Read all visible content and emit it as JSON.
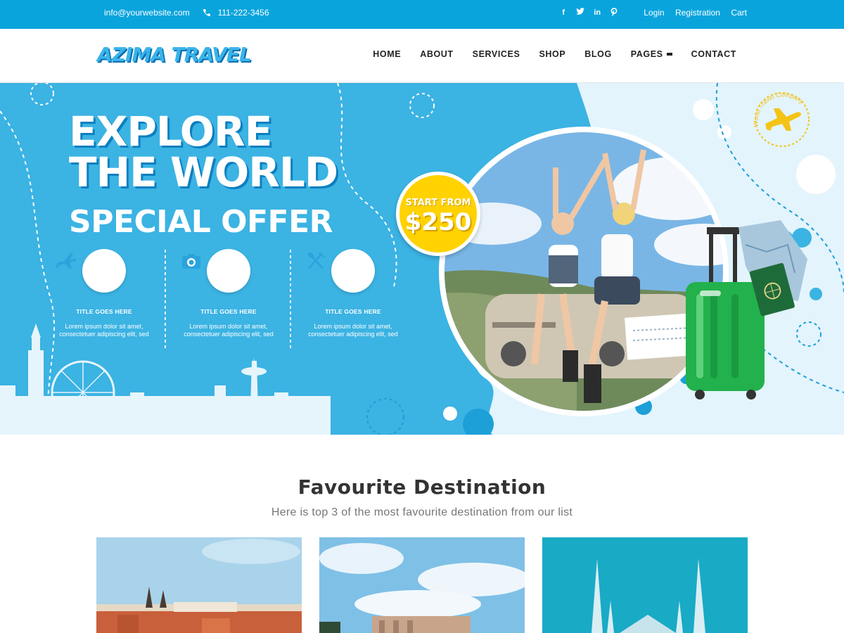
{
  "topbar": {
    "email": "info@yourwebsite.com",
    "phone": "111-222-3456",
    "social_icons": [
      "facebook-icon",
      "twitter-icon",
      "linkedin-icon",
      "pinterest-icon"
    ],
    "links": [
      "Login",
      "Registration",
      "Cart"
    ]
  },
  "header": {
    "logo": "AZIMA TRAVEL",
    "nav": [
      "HOME",
      "ABOUT",
      "SERVICES",
      "SHOP",
      "BLOG",
      "PAGES",
      "CONTACT"
    ]
  },
  "hero": {
    "headline_line1": "EXPLORE",
    "headline_line2": "THE WORLD",
    "special_offer": "SPECIAL OFFER",
    "badge_label": "START FROM",
    "badge_price": "$250",
    "stamp_text": "World Travel Company",
    "features": [
      {
        "icon": "airplane-icon",
        "title": "TITLE GOES HERE",
        "text": "Lorem ipsum dolor sit amet, consectetuer adipiscing elit, sed"
      },
      {
        "icon": "camera-icon",
        "title": "TITLE GOES HERE",
        "text": "Lorem ipsum dolor sit amet, consectetuer adipiscing elit, sed"
      },
      {
        "icon": "fork-knife-icon",
        "title": "TITLE GOES HERE",
        "text": "Lorem ipsum dolor sit amet, consectetuer adipiscing elit, sed"
      }
    ],
    "colors": {
      "primary": "#0aa4dd",
      "hero_bg": "#3bb3e3",
      "badge": "#ffd200",
      "suitcase": "#22b14c"
    }
  },
  "destinations": {
    "title": "Favourite Destination",
    "subtitle": "Here is top 3 of the most favourite destination from our list"
  }
}
